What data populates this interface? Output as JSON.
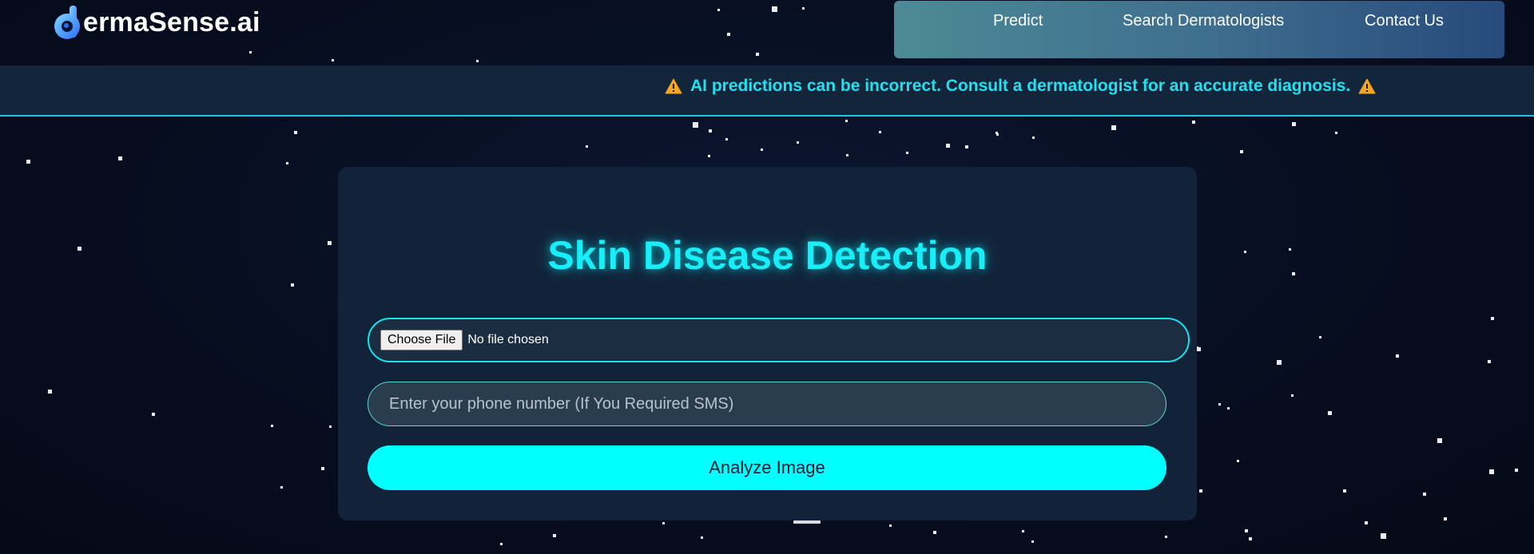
{
  "header": {
    "logo_text": "ermaSense.ai",
    "nav": {
      "predict": "Predict",
      "search_dermatologists": "Search Dermatologists",
      "contact_us": "Contact Us"
    }
  },
  "banner": {
    "text": "AI predictions can be incorrect. Consult a dermatologist for an accurate diagnosis."
  },
  "form": {
    "title": "Skin Disease Detection",
    "file_button": "Choose File",
    "file_status": "No file chosen",
    "phone_placeholder": "Enter your phone number (If You Required SMS)",
    "phone_value": "",
    "submit_label": "Analyze Image"
  },
  "colors": {
    "accent": "#00ffff",
    "background": "#070d1f",
    "card": "#122339",
    "warning_icon": "#f5a623"
  }
}
